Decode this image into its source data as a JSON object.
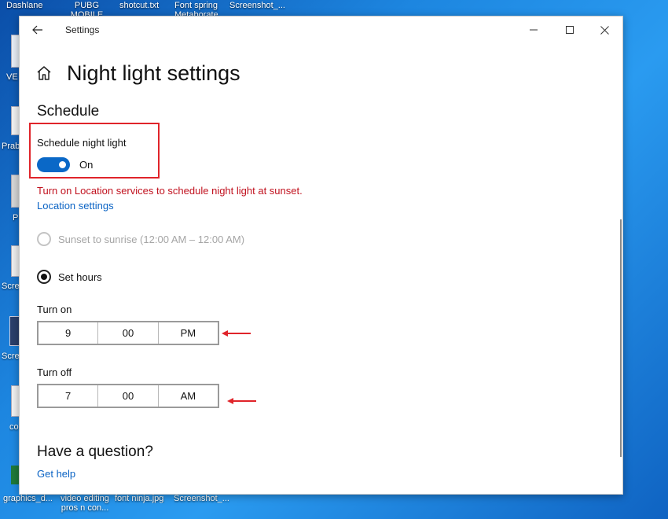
{
  "desktop": {
    "top_labels": [
      "Dashlane",
      "PUBG MOBILE",
      "shotcut.txt",
      "Font spring Metaborate",
      "Screenshot_..."
    ],
    "left_labels": [
      "VE",
      "Prab",
      "P",
      "Scre",
      "Scre",
      "co"
    ],
    "bottom_labels": [
      "graphics_d...",
      "video editing pros n con...",
      "font ninja.jpg",
      "Screenshot_..."
    ]
  },
  "window": {
    "app_title": "Settings",
    "page_title": "Night light settings",
    "schedule": {
      "section_title": "Schedule",
      "toggle_label": "Schedule night light",
      "toggle_state": "On",
      "warning": "Turn on Location services to schedule night light at sunset.",
      "location_link": "Location settings",
      "option_sunset": "Sunset to sunrise (12:00 AM – 12:00 AM)",
      "option_set_hours": "Set hours",
      "turn_on": {
        "label": "Turn on",
        "hour": "9",
        "minute": "00",
        "period": "PM"
      },
      "turn_off": {
        "label": "Turn off",
        "hour": "7",
        "minute": "00",
        "period": "AM"
      }
    },
    "help": {
      "section_title": "Have a question?",
      "link": "Get help"
    }
  },
  "colors": {
    "accent": "#0a68c7",
    "warning": "#c1121f",
    "highlight": "#e0242a",
    "link": "#0a63c4"
  }
}
